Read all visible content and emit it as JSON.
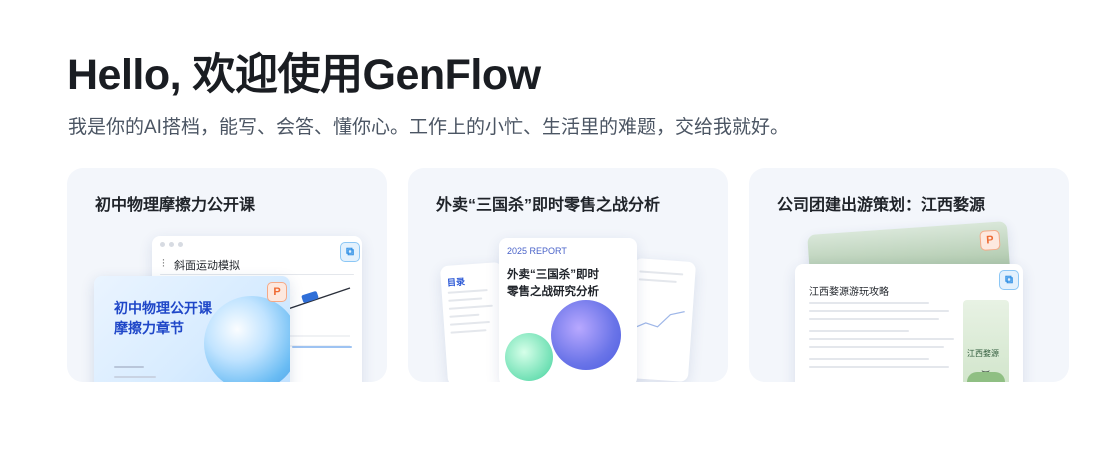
{
  "header": {
    "title": "Hello, 欢迎使用GenFlow",
    "subtitle": "我是你的AI搭档，能写、会答、懂你心。工作上的小忙、生活里的难题，交给我就好。"
  },
  "cards": [
    {
      "title": "初中物理摩擦力公开课",
      "preview_window_title": "斜面运动模拟",
      "slide_title_line1": "初中物理公开课",
      "slide_title_line2": "摩擦力章节"
    },
    {
      "title": "外卖“三国杀”即时零售之战分析",
      "toc_label": "目录",
      "report_label": "2025 REPORT",
      "report_title_line1": "外卖“三国杀”即时",
      "report_title_line2": "零售之战研究分析"
    },
    {
      "title": "公司团建出游策划：江西婺源",
      "doc_title": "江西婺源游玩攻略",
      "poster_label": "江西婺源"
    }
  ],
  "colors": {
    "card_bg": "#f3f6fb",
    "accent_blue": "#2b8de5",
    "accent_orange": "#ee6a33",
    "slide_text": "#1f47c8"
  }
}
